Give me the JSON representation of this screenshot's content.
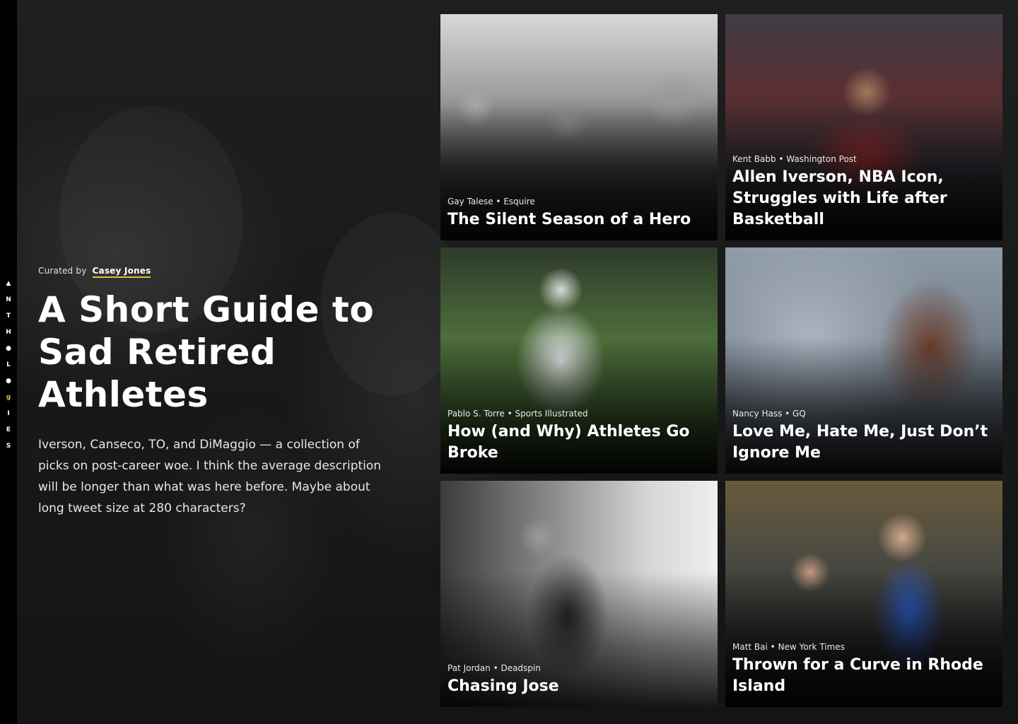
{
  "brand": {
    "letters": [
      "▲",
      "N",
      "T",
      "H",
      "●",
      "L",
      "●",
      "g",
      "I",
      "E",
      "S"
    ]
  },
  "intro": {
    "curated_prefix": "Curated by",
    "curator": "Casey Jones",
    "title": "A Short Guide to Sad Retired Athletes",
    "description": "Iverson, Canseco, TO, and DiMaggio — a collection of picks on post-career woe. I think the average description will be longer than what was here before. Maybe about long tweet size at 280 characters?"
  },
  "cards": [
    {
      "byline": "Gay Talese • Esquire",
      "headline": "The Silent Season of a Hero"
    },
    {
      "byline": "Kent Babb • Washington Post",
      "headline": "Allen Iverson, NBA Icon, Struggles with Life after Basketball"
    },
    {
      "byline": "Pablo S. Torre • Sports Illustrated",
      "headline": "How (and Why) Athletes Go Broke"
    },
    {
      "byline": "Nancy Hass • GQ",
      "headline": "Love Me, Hate Me, Just Don’t Ignore Me"
    },
    {
      "byline": "Pat Jordan • Deadspin",
      "headline": "Chasing Jose"
    },
    {
      "byline": "Matt Bai • New York Times",
      "headline": "Thrown for a Curve in Rhode Island"
    }
  ],
  "colors": {
    "accent": "#e0c13a",
    "background": "#171717",
    "rail": "#000000"
  }
}
